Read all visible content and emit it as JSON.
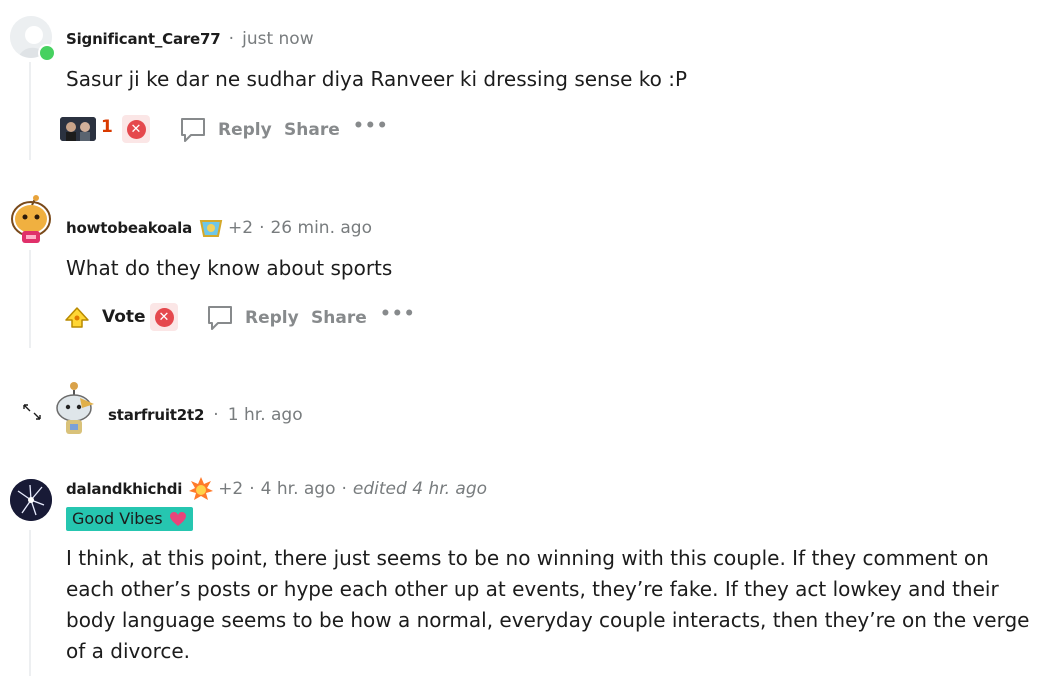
{
  "comments": [
    {
      "username": "Significant_Care77",
      "time": "just now",
      "body": "Sasur ji ke dar ne sudhar diya Ranveer ki dressing sense ko :P",
      "score": "1",
      "reply": "Reply",
      "share": "Share",
      "more": "•••"
    },
    {
      "username": "howtobeakoala",
      "award_count": "+2",
      "time": "26 min. ago",
      "body": "What do they know about sports",
      "vote": "Vote",
      "reply": "Reply",
      "share": "Share",
      "more": "•••"
    },
    {
      "username": "starfruit2t2",
      "time": "1 hr. ago",
      "expand_icon": "expand-arrows-icon"
    },
    {
      "username": "dalandkhichdi",
      "award_count": "+2",
      "time": "4 hr. ago",
      "edited": "edited 4 hr. ago",
      "flair": "Good Vibes",
      "flair_color": "#26c6b0",
      "body": "I think, at this point, there just seems to be no winning with this couple. If they comment on each other’s posts or hype each other up at events, they’re fake. If they act lowkey and their body language seems to be how a normal, everyday couple interacts, then they’re on the verge of a divorce."
    }
  ],
  "colors": {
    "online": "#46d160",
    "score_red": "#d93a00",
    "muted": "#787c7e",
    "thread_line": "#edeff1"
  },
  "separator": "·"
}
